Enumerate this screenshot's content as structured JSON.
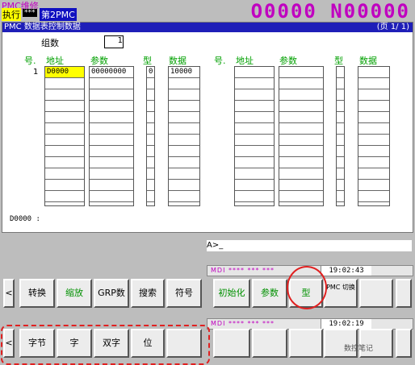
{
  "header": {
    "mode_title": "PMC维修",
    "exec": "执行",
    "dots": "***",
    "selected": "第2PMC",
    "program": "O0000 N00000"
  },
  "screen": {
    "title": "PMC 数据表控制数据",
    "page": "(页    1/   1)",
    "group_label": "组数",
    "group_value": "1",
    "columns_left": [
      "号.",
      "地址",
      "参数",
      "型",
      "数据"
    ],
    "columns_right": [
      "号.",
      "地址",
      "参数",
      "型",
      "数据"
    ],
    "row": {
      "num": "1",
      "addr": "D0000",
      "param": "00000000",
      "type": "0",
      "data": "10000"
    },
    "footer_addr": "D0000 :"
  },
  "command_line": "A>_",
  "status1": {
    "mode": "MDI **** *** ***",
    "time": "19:02:43"
  },
  "status2": {
    "mode": "MDI **** *** ***",
    "time": "19:02:19"
  },
  "softkeys_row1": {
    "left_arrow": "<",
    "keys": [
      "转换",
      "缩放",
      "GRP数",
      "搜索",
      "符号",
      "初始化",
      "参数",
      "型",
      "PMC 切换",
      ""
    ]
  },
  "softkeys_row2": {
    "left_arrow": "<",
    "keys": [
      "字节",
      "字",
      "双字",
      "位",
      "",
      "",
      "",
      "",
      "",
      ""
    ]
  },
  "watermark": "数控笔记"
}
